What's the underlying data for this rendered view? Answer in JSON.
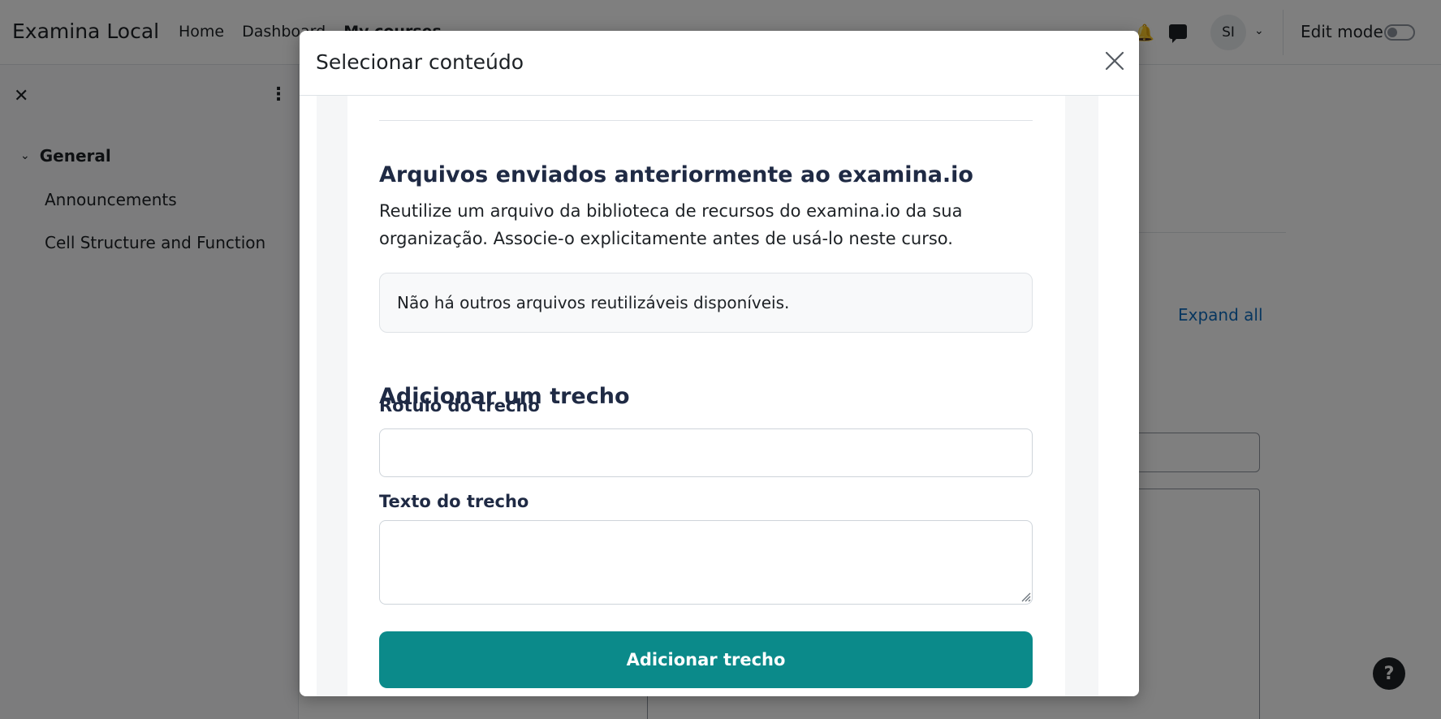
{
  "navbar": {
    "brand": "Examina Local",
    "links": [
      "Home",
      "Dashboard",
      "My courses"
    ],
    "avatar_initials": "SI",
    "edit_mode_label": "Edit mode"
  },
  "drawer": {
    "section": "General",
    "items": [
      "Announcements",
      "Cell Structure and Function"
    ]
  },
  "main": {
    "expand_all": "Expand all"
  },
  "help": {
    "label": "?"
  },
  "modal": {
    "title": "Selecionar conteúdo",
    "previous_files": {
      "title": "Arquivos enviados anteriormente ao examina.io",
      "description": "Reutilize um arquivo da biblioteca de recursos do examina.io da sua organização. Associe-o explicitamente antes de usá-lo neste curso.",
      "empty_message": "Não há outros arquivos reutilizáveis disponíveis."
    },
    "add_snippet": {
      "title": "Adicionar um trecho",
      "label_field": "Rótulo do trecho",
      "label_value": "",
      "text_field": "Texto do trecho",
      "text_value": "",
      "button": "Adicionar trecho"
    }
  },
  "colors": {
    "primary_button": "#0b8a8a",
    "link": "#0f6cbf",
    "heading": "#1f2a44"
  }
}
